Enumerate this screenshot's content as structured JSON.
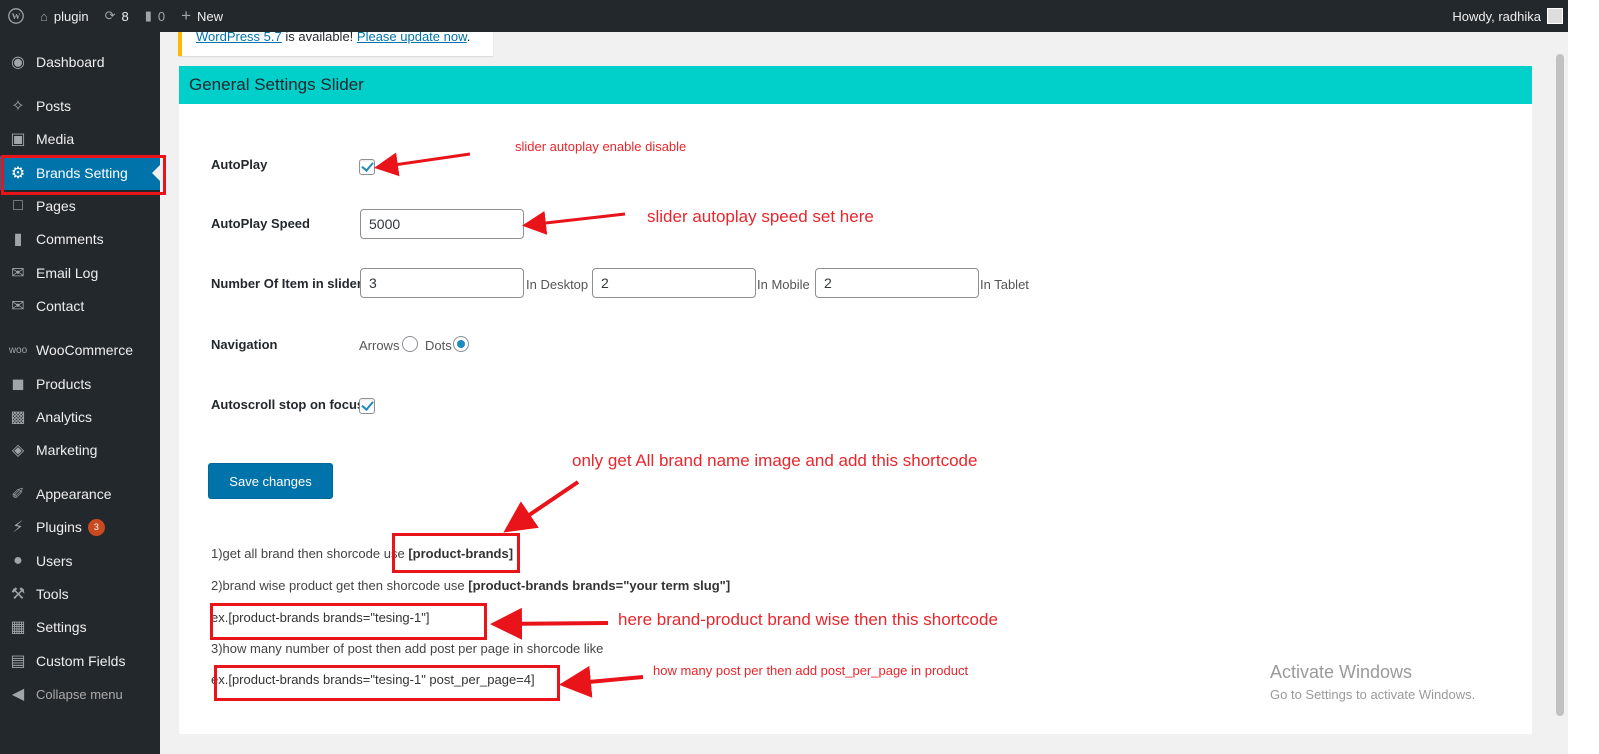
{
  "adminbar": {
    "site_name": "plugin",
    "updates_count": "8",
    "comments_count": "0",
    "new_label": "New",
    "howdy": "Howdy, radhika"
  },
  "sidebar": {
    "items": [
      {
        "label": "Dashboard",
        "icon": "dashboard-icon"
      },
      {
        "label": "Posts",
        "icon": "pin-icon"
      },
      {
        "label": "Media",
        "icon": "media-icon"
      },
      {
        "label": "Brands Setting",
        "icon": "gear-icon"
      },
      {
        "label": "Pages",
        "icon": "pages-icon"
      },
      {
        "label": "Comments",
        "icon": "comment-icon"
      },
      {
        "label": "Email Log",
        "icon": "email-icon"
      },
      {
        "label": "Contact",
        "icon": "contact-icon"
      },
      {
        "label": "WooCommerce",
        "icon": "woo-icon"
      },
      {
        "label": "Products",
        "icon": "box-icon"
      },
      {
        "label": "Analytics",
        "icon": "bar-chart-icon"
      },
      {
        "label": "Marketing",
        "icon": "megaphone-icon"
      },
      {
        "label": "Appearance",
        "icon": "brush-icon"
      },
      {
        "label": "Plugins",
        "icon": "plug-icon",
        "badge": "3"
      },
      {
        "label": "Users",
        "icon": "user-icon"
      },
      {
        "label": "Tools",
        "icon": "wrench-icon"
      },
      {
        "label": "Settings",
        "icon": "settings-icon"
      },
      {
        "label": "Custom Fields",
        "icon": "table-icon"
      },
      {
        "label": "Collapse menu",
        "icon": "collapse-icon"
      }
    ]
  },
  "notice": {
    "link1": "WordPress 5.7",
    "middle": " is available! ",
    "link2": "Please update now",
    "end": "."
  },
  "panel": {
    "title": "General Settings Slider",
    "autoplay_label": "AutoPlay",
    "speed_label": "AutoPlay Speed",
    "speed_value": "5000",
    "items_label": "Number Of Item in slider",
    "desktop_value": "3",
    "desktop_suffix": "In Desktop",
    "mobile_value": "2",
    "mobile_suffix": "In Mobile",
    "tablet_value": "2",
    "tablet_suffix": "In Tablet",
    "nav_label": "Navigation",
    "arrows_label": "Arrows",
    "dots_label": "Dots",
    "navigation_selected": "Dots",
    "autoscroll_label": "Autoscroll stop on focus",
    "save_label": "Save changes",
    "line1_text": "1)get  all brand then shorcode use ",
    "line1_code": "[product-brands]",
    "line2_text": "2)brand wise product  get then shorcode use ",
    "line2_code": "[product-brands brands=\"your term slug\"]",
    "line3_text": "ex.[product-brands  brands=\"tesing-1\"]",
    "line4_text": "3)how many number of post then add post per page in shorcode like",
    "line5_text": "ex.[product-brands  brands=\"tesing-1\" post_per_page=4]"
  },
  "annotations": {
    "autoplay_note": "slider autoplay enable disable",
    "speed_note": "slider autoplay speed set here",
    "shortcode_note": "only get All brand name image and add this shortcode",
    "brandwise_note": "here brand-product brand wise then this shortcode",
    "perpage_note": "how many post per then add post_per_page in product"
  },
  "watermark": {
    "title": "Activate Windows",
    "subtitle": "Go to Settings to activate Windows."
  },
  "colors": {
    "adminbar": "#23282d",
    "sidebar_active": "#0073aa",
    "panel_header": "#00cfca",
    "annotation_red": "#e8262c",
    "button": "#0073aa"
  }
}
